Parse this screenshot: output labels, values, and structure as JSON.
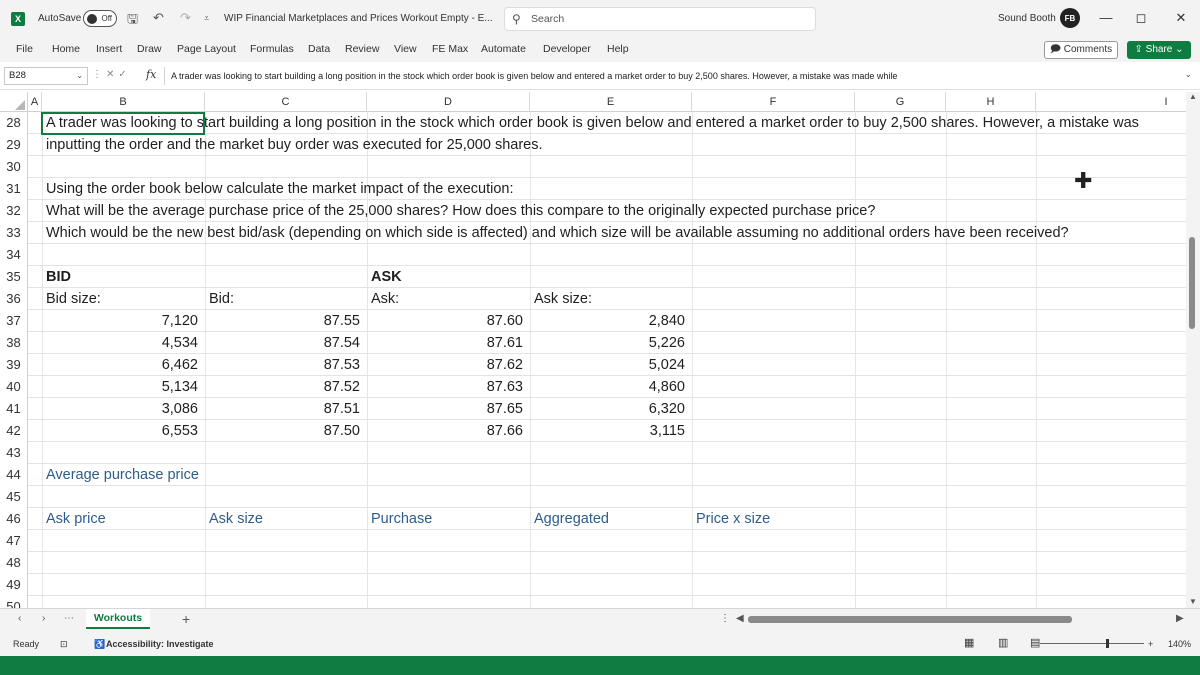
{
  "window": {
    "app_logo": "X",
    "autosave_label": "AutoSave",
    "autosave_state": "Off",
    "doc_title": "WIP Financial Marketplaces and Prices Workout Empty  -  E...",
    "search_placeholder": "Search",
    "user_name": "Sound Booth",
    "avatar_initials": "FB",
    "minimize_icon": "—",
    "restore_icon": "◻",
    "close_icon": "✕"
  },
  "ribbon": {
    "tabs": [
      "File",
      "Home",
      "Insert",
      "Draw",
      "Page Layout",
      "Formulas",
      "Data",
      "Review",
      "View",
      "FE Max",
      "Automate",
      "Developer",
      "Help"
    ],
    "comments_label": "Comments",
    "share_label": "Share"
  },
  "formula_bar": {
    "name_box": "B28",
    "fx": "fx",
    "content": "A trader was looking to start building a long position in the stock which order book is given below and entered a market order to buy 2,500 shares. However, a mistake was made while"
  },
  "columns": [
    "A",
    "B",
    "C",
    "D",
    "E",
    "F",
    "G",
    "H",
    "I"
  ],
  "rows": [
    {
      "num": "28",
      "cells": {
        "B": "A trader was looking to start building a long position in the stock which order book is given below and entered a market order to buy 2,500 shares. However, a mistake was"
      }
    },
    {
      "num": "29",
      "cells": {
        "B": "inputting the order and the market buy order was executed for 25,000 shares."
      }
    },
    {
      "num": "30",
      "cells": {}
    },
    {
      "num": "31",
      "cells": {
        "B": "Using the order book below calculate the market impact of the execution:"
      }
    },
    {
      "num": "32",
      "cells": {
        "B": "What will be the average purchase price of the 25,000 shares? How does this compare to the originally expected purchase price?"
      }
    },
    {
      "num": "33",
      "cells": {
        "B": "Which would be the new best bid/ask (depending on which side is affected) and which size will be available assuming no additional orders have been received?"
      }
    },
    {
      "num": "34",
      "cells": {}
    },
    {
      "num": "35",
      "cells": {
        "B": "BID",
        "D": "ASK"
      }
    },
    {
      "num": "36",
      "cells": {
        "B": "Bid size:",
        "C": "Bid:",
        "D": "Ask:",
        "E": "Ask size:"
      }
    },
    {
      "num": "37",
      "cells": {
        "B": "7,120",
        "C": "87.55",
        "D": "87.60",
        "E": "2,840"
      }
    },
    {
      "num": "38",
      "cells": {
        "B": "4,534",
        "C": "87.54",
        "D": "87.61",
        "E": "5,226"
      }
    },
    {
      "num": "39",
      "cells": {
        "B": "6,462",
        "C": "87.53",
        "D": "87.62",
        "E": "5,024"
      }
    },
    {
      "num": "40",
      "cells": {
        "B": "5,134",
        "C": "87.52",
        "D": "87.63",
        "E": "4,860"
      }
    },
    {
      "num": "41",
      "cells": {
        "B": "3,086",
        "C": "87.51",
        "D": "87.65",
        "E": "6,320"
      }
    },
    {
      "num": "42",
      "cells": {
        "B": "6,553",
        "C": "87.50",
        "D": "87.66",
        "E": "3,115"
      }
    },
    {
      "num": "43",
      "cells": {}
    },
    {
      "num": "44",
      "cells": {
        "B": "Average purchase price"
      }
    },
    {
      "num": "45",
      "cells": {}
    },
    {
      "num": "46",
      "cells": {
        "B": "Ask price",
        "C": "Ask size",
        "D": "Purchase",
        "E": "Aggregated",
        "F": "Price x size"
      }
    },
    {
      "num": "47",
      "cells": {}
    },
    {
      "num": "48",
      "cells": {}
    },
    {
      "num": "49",
      "cells": {}
    },
    {
      "num": "50",
      "cells": {}
    }
  ],
  "sheet_tabs": {
    "active": "Workouts",
    "add_icon": "+"
  },
  "status": {
    "ready": "Ready",
    "accessibility": "Accessibility: Investigate",
    "zoom": "140%"
  },
  "colors": {
    "accent": "#107c41",
    "label_blue": "#2e5c8a"
  }
}
